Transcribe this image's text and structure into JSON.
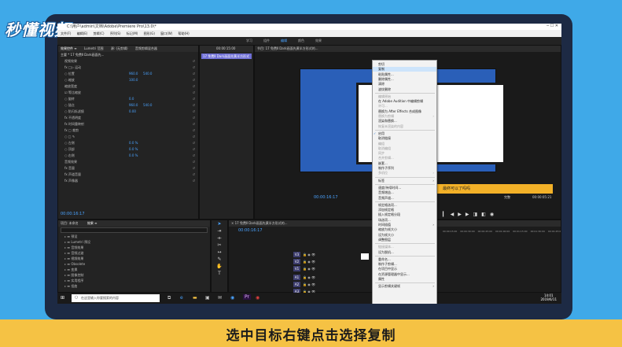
{
  "brand": {
    "logo_text": "秒懂视频"
  },
  "caption": "选中目标右键点击选择复制",
  "app": {
    "title": "C:\\用户\\admin\\文档\\Adobe\\Premiere Pro\\13.0\\*",
    "menus": [
      "文件(F)",
      "编辑(E)",
      "剪辑(C)",
      "序列(S)",
      "标记(M)",
      "图形(G)",
      "窗口(W)",
      "帮助(H)"
    ],
    "workspaces": [
      "学习",
      "组件",
      "编辑",
      "颜色",
      "效果"
    ]
  },
  "effect_controls": {
    "tabs": [
      "效果控件 ≡",
      "Lumetri 范围",
      "源: (无剪辑)",
      "音频剪辑混合器"
    ],
    "clip_header": "主要 * 17 免费Ⅱ Dark画面先...",
    "rows": [
      {
        "label": "视频效果",
        "v1": "",
        "v2": ""
      },
      {
        "label": "fx □▷ 运动",
        "v1": "",
        "v2": ""
      },
      {
        "label": "○ 位置",
        "v1": "960.0",
        "v2": "540.0"
      },
      {
        "label": "○ 缩放",
        "v1": "100.0",
        "v2": ""
      },
      {
        "label": "缩放宽度",
        "v1": "",
        "v2": ""
      },
      {
        "label": "☑ 等比缩放",
        "v1": "",
        "v2": ""
      },
      {
        "label": "○ 旋转",
        "v1": "0.0",
        "v2": ""
      },
      {
        "label": "○ 锚点",
        "v1": "960.0",
        "v2": "540.0"
      },
      {
        "label": "○ 防闪烁滤镜",
        "v1": "0.00",
        "v2": ""
      },
      {
        "label": "fx 不透明度",
        "v1": "",
        "v2": ""
      },
      {
        "label": "fx 时间重映射",
        "v1": "",
        "v2": ""
      },
      {
        "label": "fx □ 裁剪",
        "v1": "",
        "v2": ""
      },
      {
        "label": "○ □ ✎",
        "v1": "",
        "v2": ""
      },
      {
        "label": "○ 左侧",
        "v1": "0.0 %",
        "v2": ""
      },
      {
        "label": "○ 顶部",
        "v1": "0.0 %",
        "v2": ""
      },
      {
        "label": "○ 右侧",
        "v1": "0.0 %",
        "v2": ""
      },
      {
        "label": "音频效果",
        "v1": "",
        "v2": ""
      },
      {
        "label": "fx 音量",
        "v1": "",
        "v2": ""
      },
      {
        "label": "fx 声道音量",
        "v1": "",
        "v2": ""
      },
      {
        "label": "fx 声像器",
        "v1": "",
        "v2": ""
      }
    ],
    "timecode": "00:00:16:17"
  },
  "source_clip": {
    "label": "17 免费Ⅱ Dark画面先黄半方形式",
    "timecode": "00:00:15:00"
  },
  "program_monitor": {
    "tab": "节目: 17 免费Ⅱ Dark画面先黄半方形式的...",
    "banner": "最终可以了吗吗",
    "timecode_left": "00:00:16:17",
    "fit": "完整",
    "timecode_right": "00:00:05:21"
  },
  "project_panel": {
    "tabs": [
      "项目: 未命名",
      "效果 ≡"
    ],
    "search_placeholder": "",
    "items": [
      "预设",
      "Lumetri 预设",
      "音频效果",
      "音频过渡",
      "视频效果",
      "Obsolete",
      "变换",
      "图像控制",
      "实用程序",
      "扭曲",
      "时间",
      "杂色与颗粒",
      "模糊与锐化",
      "沉浸式视频",
      "生成",
      "视频",
      "调整",
      "过时",
      "过渡",
      "透视",
      "通道",
      "键控",
      "颜色校正",
      "风格化",
      "视频过渡",
      "裁剪",
      "径向擦除",
      "渐变"
    ]
  },
  "timeline": {
    "tab": "× 17 免费Ⅱ Dark画面先黄半方形式的...",
    "timecode": "00:00:16:17",
    "video_tracks": [
      "V3",
      "V2",
      "V1"
    ],
    "audio_tracks": [
      "A1",
      "A2",
      "A3"
    ],
    "ruler_labels": [
      "00:00:15:00",
      "00:00:30:00",
      "00:00:45:00",
      "00:01:00:00",
      "00:01:15:00",
      "00:01:30:00",
      "00:01:45:00",
      "00:02:00:00"
    ]
  },
  "context_menu": {
    "items": [
      {
        "label": "剪切",
        "state": "normal"
      },
      {
        "label": "复制",
        "state": "highlighted"
      },
      {
        "label": "粘贴属性...",
        "state": "normal"
      },
      {
        "label": "删除属性...",
        "state": "normal"
      },
      {
        "label": "清除",
        "state": "normal"
      },
      {
        "label": "波纹删除",
        "state": "normal"
      },
      {
        "sep": true
      },
      {
        "label": "编辑原始",
        "state": "disabled"
      },
      {
        "label": "在 Adobe Audition 中编辑剪辑",
        "state": "normal"
      },
      {
        "label": "许可...",
        "state": "disabled"
      },
      {
        "label": "替换为 After Effects 合成图像",
        "state": "normal"
      },
      {
        "label": "替换为剪辑",
        "state": "disabled",
        "sub": true
      },
      {
        "label": "渲染和替换...",
        "state": "normal"
      },
      {
        "label": "恢复未渲染的内容",
        "state": "disabled"
      },
      {
        "sep": true
      },
      {
        "label": "启用",
        "state": "check"
      },
      {
        "label": "取消链接",
        "state": "normal"
      },
      {
        "label": "编组",
        "state": "disabled"
      },
      {
        "label": "取消编组",
        "state": "disabled"
      },
      {
        "label": "同步",
        "state": "disabled"
      },
      {
        "label": "合并剪辑...",
        "state": "disabled"
      },
      {
        "label": "嵌套...",
        "state": "normal"
      },
      {
        "label": "制作子序列",
        "state": "normal"
      },
      {
        "label": "多机位",
        "state": "disabled",
        "sub": true
      },
      {
        "sep": true
      },
      {
        "label": "标签",
        "state": "normal",
        "sub": true
      },
      {
        "sep": true
      },
      {
        "label": "速度/持续时间...",
        "state": "normal"
      },
      {
        "label": "音频增益...",
        "state": "normal"
      },
      {
        "label": "音频声道...",
        "state": "normal"
      },
      {
        "sep": true
      },
      {
        "label": "帧定格选项...",
        "state": "normal"
      },
      {
        "label": "添加帧定格",
        "state": "normal"
      },
      {
        "label": "插入帧定格分段",
        "state": "normal"
      },
      {
        "label": "场选项...",
        "state": "normal"
      },
      {
        "label": "时间插值",
        "state": "normal",
        "sub": true
      },
      {
        "label": "缩放为帧大小",
        "state": "normal"
      },
      {
        "label": "设为帧大小",
        "state": "normal"
      },
      {
        "label": "调整图层",
        "state": "normal"
      },
      {
        "sep": true
      },
      {
        "label": "链接媒体...",
        "state": "disabled"
      },
      {
        "label": "设为脱机...",
        "state": "normal"
      },
      {
        "sep": true
      },
      {
        "label": "重命名...",
        "state": "normal"
      },
      {
        "label": "制作子剪辑...",
        "state": "normal"
      },
      {
        "label": "在项目中显示",
        "state": "normal"
      },
      {
        "label": "在资源管理器中显示...",
        "state": "normal"
      },
      {
        "label": "属性",
        "state": "normal"
      },
      {
        "sep": true
      },
      {
        "label": "显示剪辑关键帧",
        "state": "normal",
        "sub": true
      }
    ]
  },
  "taskbar": {
    "search_placeholder": "在这里输入你要搜索的内容",
    "time": "14:01",
    "date": "2019/6/11"
  },
  "colors": {
    "caption_band": "#f5c244",
    "background": "#3fa9e8",
    "menu_highlight": "#cde4fb"
  }
}
